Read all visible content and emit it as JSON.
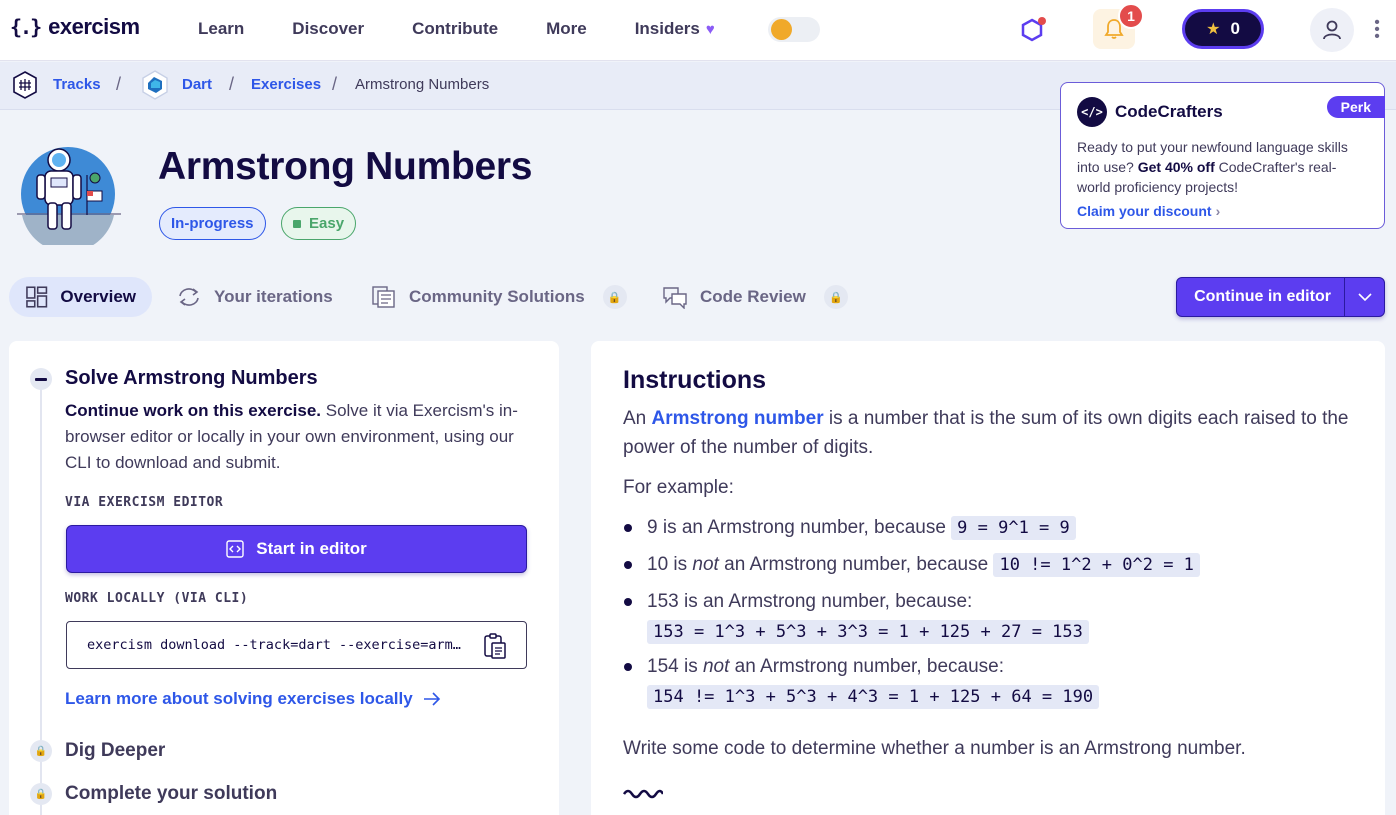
{
  "nav": {
    "logo_mark": "{.}",
    "logo_text": "exercism",
    "links": [
      "Learn",
      "Discover",
      "Contribute",
      "More",
      "Insiders"
    ],
    "notification_count": "1",
    "reputation": "0"
  },
  "breadcrumb": {
    "tracks": "Tracks",
    "separator": "/",
    "track": "Dart",
    "exercises": "Exercises",
    "current": "Armstrong Numbers"
  },
  "perk": {
    "title": "CodeCrafters",
    "logo_text": "</>",
    "badge": "Perk",
    "body_pre": "Ready to put your newfound language skills into use? ",
    "body_bold": "Get 40% off",
    "body_post": " CodeCrafter's real-world proficiency projects!",
    "link": "Claim your discount"
  },
  "exercise": {
    "title": "Armstrong Numbers",
    "status_tag": "In-progress",
    "difficulty_tag": "Easy"
  },
  "tabs": {
    "overview": "Overview",
    "iterations": "Your iterations",
    "community": "Community Solutions",
    "review": "Code Review"
  },
  "continue_button": "Continue in editor",
  "steps": {
    "solve_title": "Solve Armstrong Numbers",
    "solve_desc_bold": "Continue work on this exercise.",
    "solve_desc_rest": " Solve it via Exercism's in-browser editor or locally in your own environment, using our CLI to download and submit.",
    "via_editor_head": "VIA EXERCISM EDITOR",
    "start_button": "Start in editor",
    "work_locally_head": "WORK LOCALLY (VIA CLI)",
    "cli_command": "exercism download --track=dart --exercise=armstrong-numbers",
    "learn_more": "Learn more about solving exercises locally",
    "dig_deeper": "Dig Deeper",
    "complete": "Complete your solution"
  },
  "instructions": {
    "title": "Instructions",
    "intro_pre": "An ",
    "intro_link": "Armstrong number",
    "intro_post": " is a number that is the sum of its own digits each raised to the power of the number of digits.",
    "for_example": "For example:",
    "items": [
      {
        "pre": "9 is an Armstrong number, because ",
        "code": "9 = 9^1 = 9"
      },
      {
        "pre_a": "10 is ",
        "em": "not",
        "pre_b": " an Armstrong number, because ",
        "code": "10 != 1^2 + 0^2 = 1"
      },
      {
        "pre": "153 is an Armstrong number, because:",
        "code": "153 = 1^3 + 5^3 + 3^3 = 1 + 125 + 27 = 153"
      },
      {
        "pre_a": "154 is ",
        "em": "not",
        "pre_b": " an Armstrong number, because:",
        "code": "154 != 1^3 + 5^3 + 4^3 = 1 + 125 + 64 = 190"
      }
    ],
    "closing": "Write some code to determine whether a number is an Armstrong number."
  },
  "colors": {
    "primary": "#5c3df0",
    "link": "#2e57e8",
    "text_dark": "#130b43",
    "easy_green": "#4aa66b"
  },
  "icons": [
    "exercism-logo",
    "heart-icon",
    "theme-toggle",
    "hexagon-icon",
    "bell-icon",
    "reputation-icon",
    "user-icon",
    "more-dots-icon",
    "tracks-icon",
    "dart-icon",
    "overview-icon",
    "iterations-icon",
    "community-icon",
    "code-review-icon",
    "lock-icon",
    "chevron-down-icon",
    "editor-icon",
    "copy-icon",
    "arrow-right-icon"
  ]
}
